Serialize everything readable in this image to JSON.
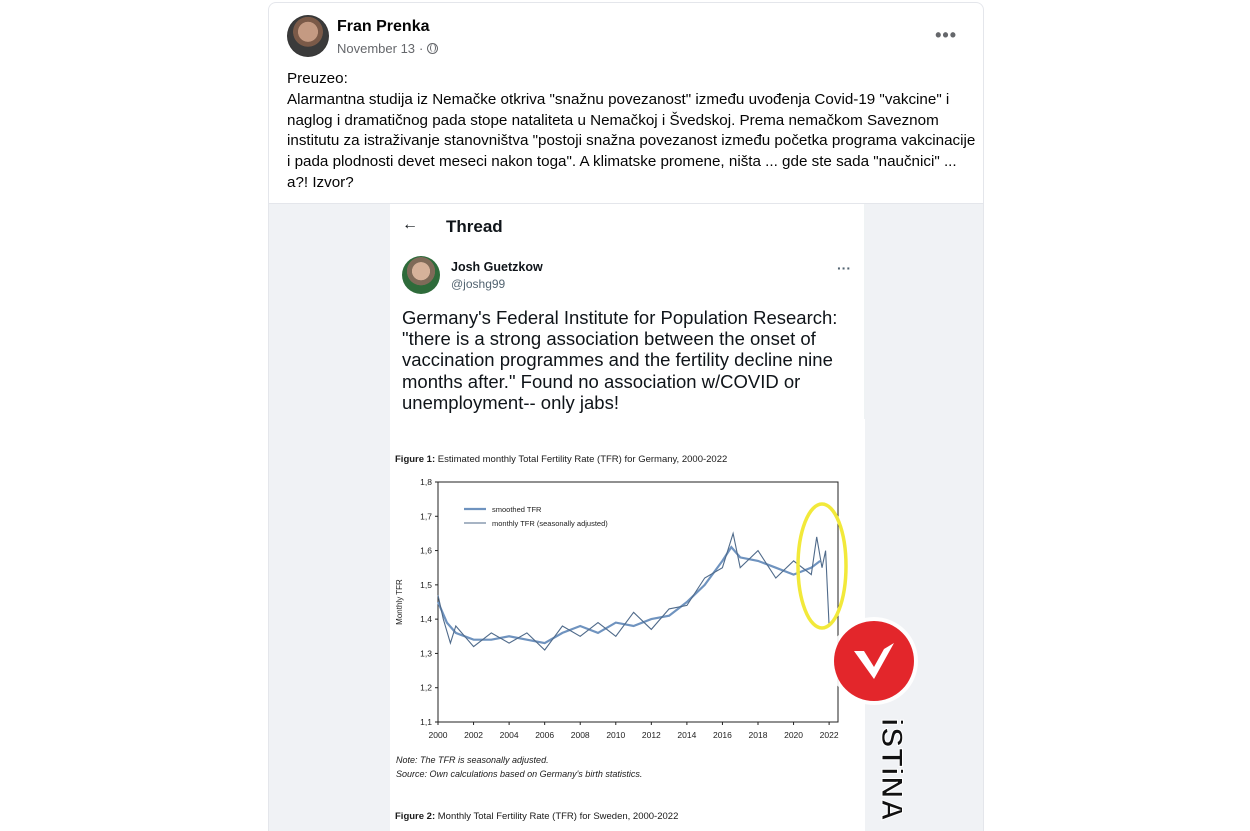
{
  "post": {
    "author": "Fran Prenka",
    "date": "November 13",
    "separator": "·",
    "privacy_icon": "globe-icon",
    "more_icon": "more-horizontal-icon",
    "more_label": "•••",
    "text": "Preuzeo:\nAlarmantna studija iz Nemačke otkriva \"snažnu povezanost\" između uvođenja Covid-19 \"vakcine\" i naglog i dramatičnog pada stope nataliteta u Nemačkoj i Švedskoj. Prema nemačkom Saveznom institutu za istraživanje stanovništva \"postoji snažna povezanost između početka programa vakcinacije i pada plodnosti devet meseci nakon toga\". A klimatske promene, ništa ... gde ste sada \"naučnici\" ... a?! Izvor?"
  },
  "tweet": {
    "back_label": "←",
    "title": "Thread",
    "name": "Josh Guetzkow",
    "handle": "@joshg99",
    "more_label": "···",
    "text": "Germany's Federal Institute for Population Research:\n\"there is a strong association between the onset of vaccination programmes and the fertility decline nine months after.\" Found no association w/COVID or unemployment-- only jabs!"
  },
  "figure": {
    "caption_bold": "Figure 1:",
    "caption": "Estimated monthly Total Fertility Rate (TFR) for Germany, 2000-2022",
    "note": "Note: The TFR is seasonally adjusted.",
    "source": "Source: Own calculations based on Germany's birth statistics.",
    "fig2_bold": "Figure 2:",
    "fig2": "Monthly Total Fertility Rate (TFR) for Sweden, 2000-2022"
  },
  "watermark": {
    "text": "iSTiNA",
    "color": "#e3262b"
  },
  "highlight_color": "#f2e93a",
  "chart_data": {
    "type": "line",
    "title": "Estimated monthly Total Fertility Rate (TFR) for Germany, 2000-2022",
    "xlabel": "",
    "ylabel": "Monthly TFR",
    "xlim": [
      2000,
      2022.5
    ],
    "ylim": [
      1.1,
      1.8
    ],
    "xticks": [
      2000,
      2002,
      2004,
      2006,
      2008,
      2010,
      2012,
      2014,
      2016,
      2018,
      2020,
      2022
    ],
    "yticks": [
      1.1,
      1.2,
      1.3,
      1.4,
      1.5,
      1.6,
      1.7,
      1.8
    ],
    "ytick_labels": [
      "1,1",
      "1,2",
      "1,3",
      "1,4",
      "1,5",
      "1,6",
      "1,7",
      "1,8"
    ],
    "legend_position": "top-left",
    "grid": false,
    "series": [
      {
        "name": "smoothed TFR",
        "color": "#6f93bf",
        "x": [
          2000,
          2000.5,
          2001,
          2002,
          2003,
          2004,
          2005,
          2006,
          2007,
          2008,
          2009,
          2010,
          2011,
          2012,
          2013,
          2014,
          2015,
          2016,
          2016.5,
          2017,
          2018,
          2019,
          2020,
          2021,
          2021.5
        ],
        "y": [
          1.45,
          1.39,
          1.36,
          1.34,
          1.34,
          1.35,
          1.34,
          1.33,
          1.36,
          1.38,
          1.36,
          1.39,
          1.38,
          1.4,
          1.41,
          1.45,
          1.5,
          1.57,
          1.61,
          1.58,
          1.57,
          1.55,
          1.53,
          1.55,
          1.57
        ]
      },
      {
        "name": "monthly TFR (seasonally adjusted)",
        "color": "#4f6a8a",
        "x": [
          2000,
          2000.3,
          2000.7,
          2001,
          2002,
          2003,
          2004,
          2005,
          2006,
          2007,
          2008,
          2009,
          2010,
          2011,
          2012,
          2013,
          2014,
          2015,
          2016,
          2016.6,
          2017,
          2018,
          2019,
          2020,
          2021,
          2021.3,
          2021.6,
          2021.8,
          2022,
          2022.3
        ],
        "y": [
          1.47,
          1.4,
          1.33,
          1.38,
          1.32,
          1.36,
          1.33,
          1.36,
          1.31,
          1.38,
          1.35,
          1.39,
          1.35,
          1.42,
          1.37,
          1.43,
          1.44,
          1.52,
          1.55,
          1.65,
          1.55,
          1.6,
          1.52,
          1.57,
          1.53,
          1.64,
          1.55,
          1.6,
          1.38,
          1.4
        ]
      }
    ]
  }
}
